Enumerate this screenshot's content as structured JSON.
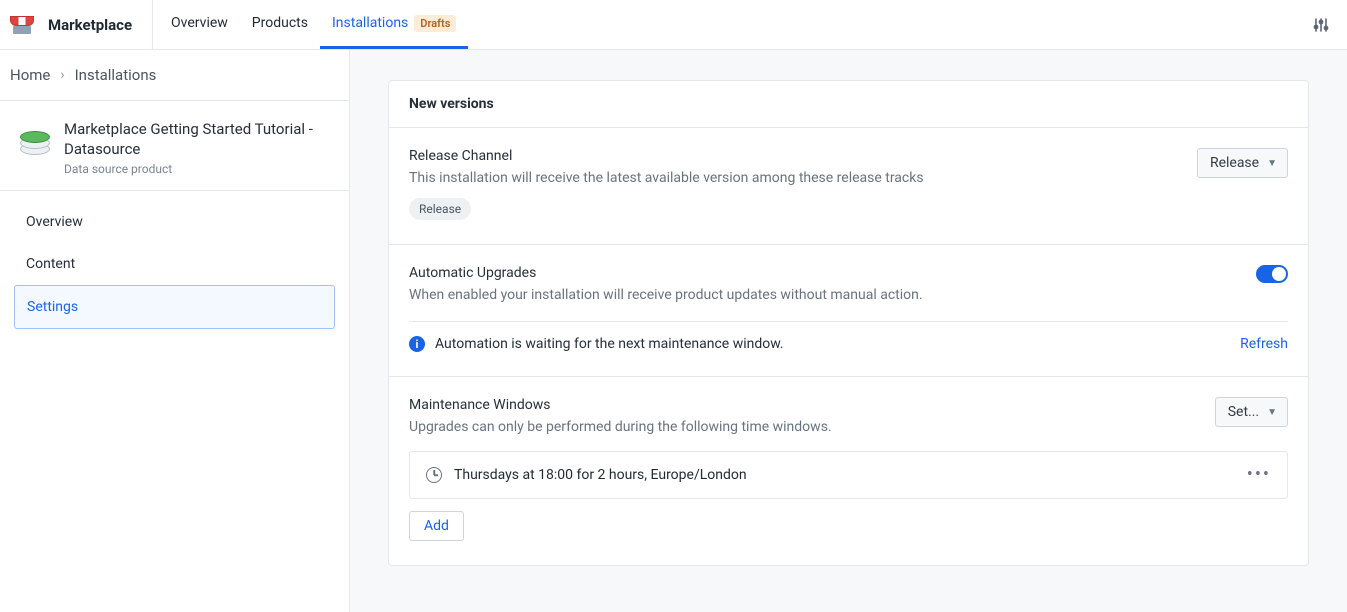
{
  "header": {
    "brand": "Marketplace",
    "tabs": {
      "overview": "Overview",
      "products": "Products",
      "installations": "Installations",
      "draftsBadge": "Drafts"
    }
  },
  "breadcrumb": {
    "home": "Home",
    "current": "Installations"
  },
  "product": {
    "title": "Marketplace Getting Started Tutorial - Datasource",
    "subtitle": "Data source product"
  },
  "sidenav": {
    "overview": "Overview",
    "content": "Content",
    "settings": "Settings"
  },
  "card": {
    "title": "New versions"
  },
  "releaseChannel": {
    "title": "Release Channel",
    "desc": "This installation will receive the latest available version among these release tracks",
    "chip": "Release",
    "button": "Release"
  },
  "autoUpgrades": {
    "title": "Automatic Upgrades",
    "desc": "When enabled your installation will receive product updates without manual action.",
    "infoText": "Automation is waiting for the next maintenance window.",
    "refresh": "Refresh"
  },
  "maintenance": {
    "title": "Maintenance Windows",
    "desc": "Upgrades can only be performed during the following time windows.",
    "button": "Set...",
    "window": "Thursdays at 18:00 for 2 hours, Europe/London",
    "add": "Add"
  }
}
